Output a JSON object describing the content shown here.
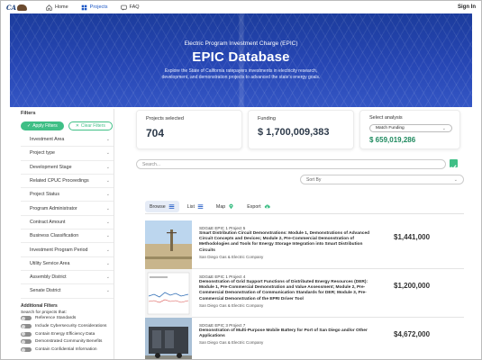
{
  "nav": {
    "logo_text": "CA",
    "items": [
      {
        "label": "Home",
        "icon": "home-icon"
      },
      {
        "label": "Projects",
        "icon": "grid-icon"
      },
      {
        "label": "FAQ",
        "icon": "faq-icon"
      }
    ],
    "signin": "Sign In"
  },
  "hero": {
    "subtitle": "Electric Program Investment Charge (EPIC)",
    "title": "EPIC Database",
    "desc_line1": "Explore the State of California ratepayers investments in electricity research,",
    "desc_line2": "development, and demonstration projects to advanced the state's energy goals."
  },
  "filters": {
    "title": "Filters",
    "apply": "Apply Filters",
    "clear": "Clear Filters",
    "items": [
      "Investment Area",
      "Project type",
      "Development Stage",
      "Related CPUC Proceedings",
      "Project Status",
      "Program Administrator",
      "Contract Amount",
      "Business Classification",
      "Investment Program Period",
      "Utility Service Area",
      "Assembly District",
      "Senate District"
    ],
    "additional_title": "Additional Filters",
    "additional_sub": "Search for projects that:",
    "toggles": [
      "Reference Standards",
      "Include Cybersecurity Considerations",
      "Contain Energy Efficiency Data",
      "Demonstrated Community Benefits",
      "Contain Confidential Information"
    ]
  },
  "stats": {
    "projects_label": "Projects selected",
    "projects_value": "704",
    "funding_label": "Funding",
    "funding_value": "$ 1,700,009,383",
    "analysis_label": "Select analysis",
    "analysis_select": "Match Funding",
    "analysis_value": "$ 659,019,286"
  },
  "search": {
    "placeholder": "Search..."
  },
  "sort": {
    "label": "Sort By"
  },
  "tabs": [
    {
      "label": "Browse",
      "icon": "list-icon"
    },
    {
      "label": "List",
      "icon": "list-icon"
    },
    {
      "label": "Map",
      "icon": "map-pin-icon"
    },
    {
      "label": "Export",
      "icon": "cloud-download-icon"
    }
  ],
  "results": [
    {
      "meta": "SDG&E EPIC 1 Project 5",
      "title": "Smart Distribution Circuit Demonstrations: Module 1, Demonstrations of Advanced Circuit Concepts and Devices; Module 2, Pre-Commercial Demonstration of Methodologies and Tools for Energy Storage Integration into Smart Distribution Circuits",
      "company": "San Diego Gas & Electric Company",
      "amount": "$1,441,000"
    },
    {
      "meta": "SDG&E EPIC 1 Project 4",
      "title": "Demonstration of Grid Support Functions of Distributed Energy Resources (DER): Module 1, Pre-Commercial Demonstration and Value Assessment; Module 2, Pre-Commercial Demonstration of Communication Standards for DER; Module 3, Pre-Commercial Demonstration of the EPRI Driver Tool",
      "company": "San Diego Gas & Electric Company",
      "amount": "$1,200,000"
    },
    {
      "meta": "SDG&E EPIC 3 Project 7",
      "title": "Demonstration of Multi-Purpose Mobile Battery for Port of San Diego and/or Other Applications",
      "company": "San Diego Gas & Electric Company",
      "amount": "$4,672,000"
    }
  ]
}
